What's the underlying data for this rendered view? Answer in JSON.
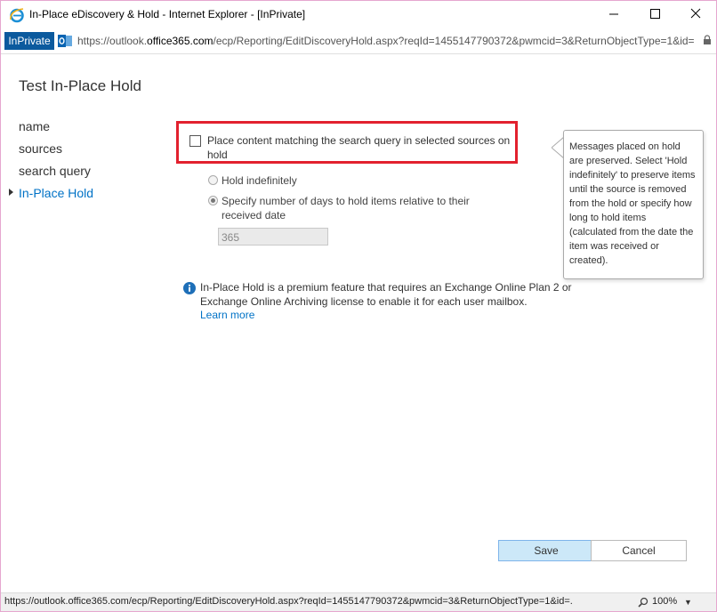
{
  "window": {
    "title": "In-Place eDiscovery & Hold - Internet Explorer - [InPrivate]"
  },
  "addressbar": {
    "inprivate_label": "InPrivate",
    "url_prefix": "https://outlook.",
    "url_domain": "office365.com",
    "url_rest": "/ecp/Reporting/EditDiscoveryHold.aspx?reqId=1455147790372&pwmcid=3&ReturnObjectType=1&id="
  },
  "page": {
    "title": "Test In-Place Hold"
  },
  "nav": {
    "items": [
      {
        "label": "name"
      },
      {
        "label": "sources"
      },
      {
        "label": "search query"
      },
      {
        "label": "In-Place Hold"
      }
    ]
  },
  "form": {
    "place_content_label": "Place content matching the search query in selected sources on hold",
    "place_content_checked": false,
    "hold_indefinitely_label": "Hold indefinitely",
    "specify_days_label": "Specify number of days to hold items relative to their received date",
    "days_value": "365"
  },
  "info": {
    "text": "In-Place Hold is a premium feature that requires an Exchange Online Plan 2 or Exchange Online Archiving license to enable it for each user mailbox.",
    "learn_more": "Learn more"
  },
  "callout": {
    "text": "Messages placed on hold are preserved. Select 'Hold indefinitely' to preserve items until the source is removed from the hold or specify how long to hold items (calculated from the date the item was received or created)."
  },
  "buttons": {
    "save": "Save",
    "cancel": "Cancel"
  },
  "statusbar": {
    "url": "https://outlook.office365.com/ecp/Reporting/EditDiscoveryHold.aspx?reqId=1455147790372&pwmcid=3&ReturnObjectType=1&id=.",
    "zoom": "100%"
  },
  "colors": {
    "accent": "#0072c6",
    "highlight_border": "#e2212e",
    "inprivate_bg": "#0b5a9e",
    "save_button_bg": "#cce8f8"
  }
}
